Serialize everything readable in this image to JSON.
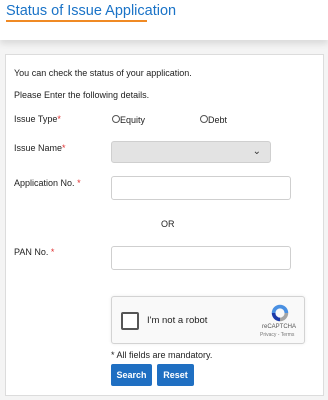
{
  "header": {
    "title": "Status of Issue Application"
  },
  "form": {
    "intro": "You can check the status of your application.",
    "instruction": "Please Enter the following details.",
    "issue_type": {
      "label": "Issue Type",
      "required_mark": "*",
      "options": [
        "Equity",
        "Debt"
      ]
    },
    "issue_name": {
      "label": "Issue Name",
      "required_mark": "*",
      "value": ""
    },
    "application_no": {
      "label": "Application No.",
      "required_mark": "*",
      "value": ""
    },
    "or_text": "OR",
    "pan_no": {
      "label": "PAN No.",
      "required_mark": "*",
      "value": ""
    },
    "captcha": {
      "label": "I'm not a robot",
      "brand": "reCAPTCHA",
      "links": "Privacy - Terms"
    },
    "mandatory_note": "* All fields are mandatory.",
    "search_label": "Search",
    "reset_label": "Reset"
  },
  "colors": {
    "title": "#1a73c7",
    "title_underline": "#f08a24",
    "button": "#1f6fc2",
    "required": "#e03030"
  }
}
